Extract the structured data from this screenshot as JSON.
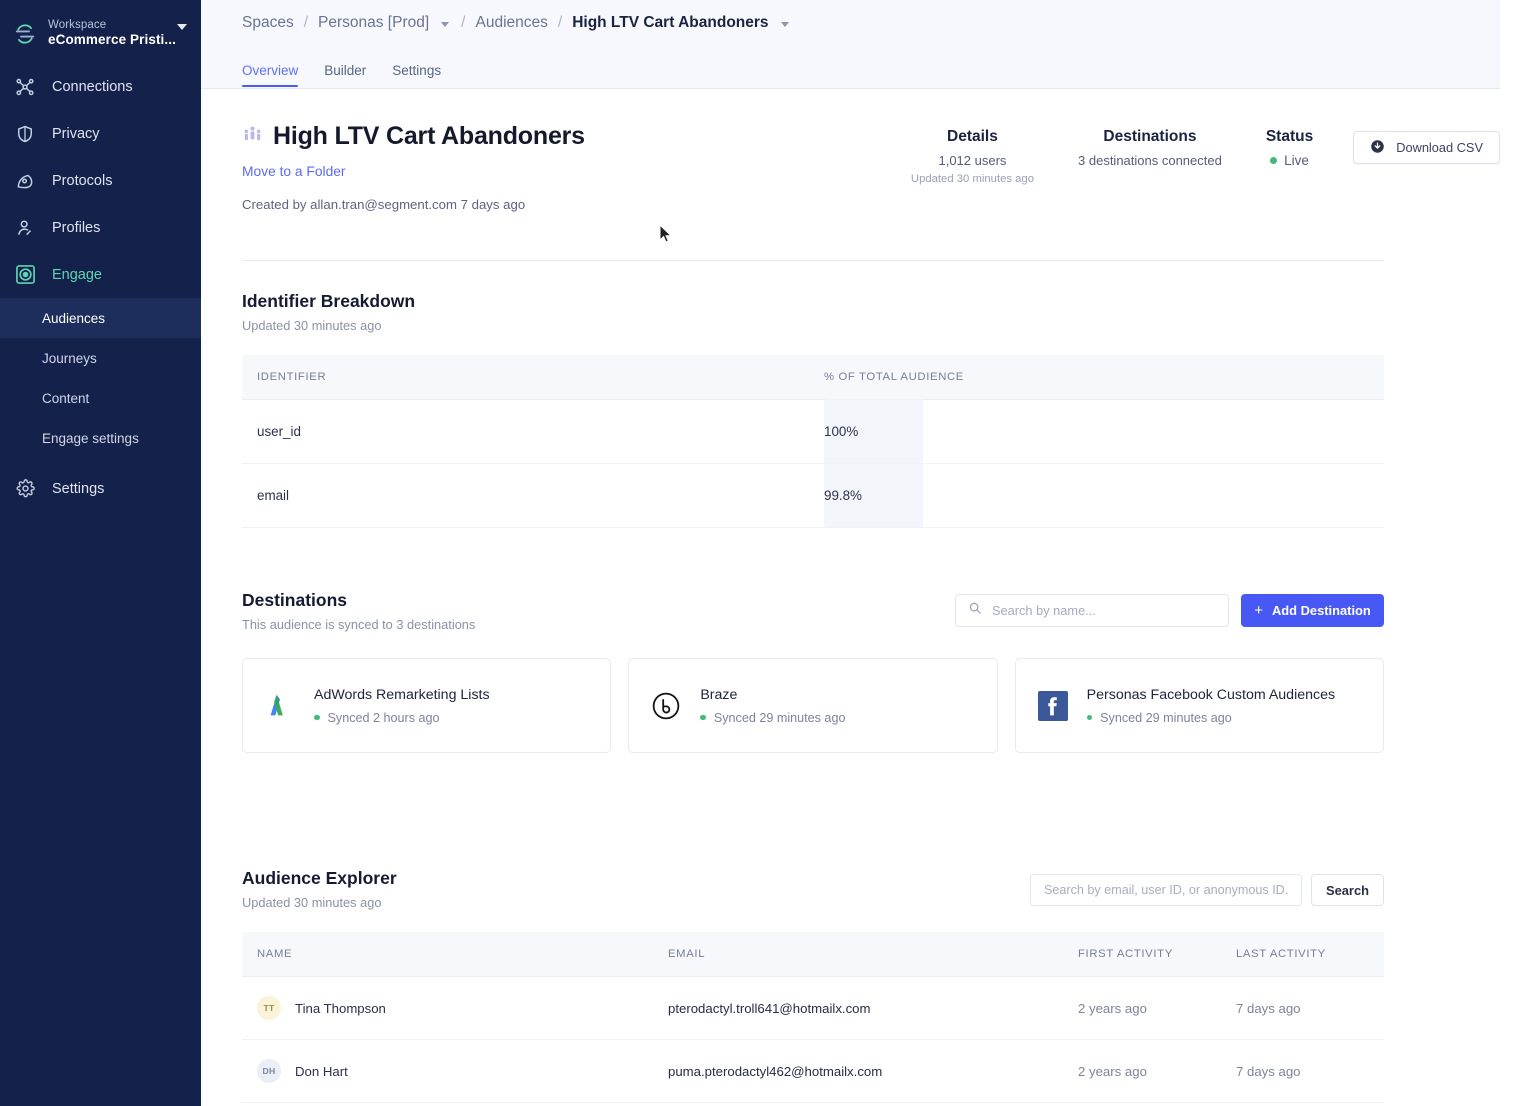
{
  "sidebar": {
    "workspace_label": "Workspace",
    "workspace_name": "eCommerce Pristi...",
    "items": [
      {
        "label": "Connections",
        "icon": "connections-icon"
      },
      {
        "label": "Privacy",
        "icon": "shield-icon"
      },
      {
        "label": "Protocols",
        "icon": "protocols-icon"
      },
      {
        "label": "Profiles",
        "icon": "person-icon"
      },
      {
        "label": "Engage",
        "icon": "engage-icon"
      }
    ],
    "sub_items": [
      {
        "label": "Audiences"
      },
      {
        "label": "Journeys"
      },
      {
        "label": "Content"
      },
      {
        "label": "Engage settings"
      }
    ],
    "settings_label": "Settings",
    "settings_icon": "gear-icon",
    "active_item": "Engage",
    "active_sub_item": "Audiences"
  },
  "breadcrumb": {
    "spaces": "Spaces",
    "space_name": "Personas [Prod]",
    "audiences": "Audiences",
    "current": "High LTV Cart Abandoners",
    "separator": "/"
  },
  "tabs": [
    {
      "label": "Overview",
      "active": true
    },
    {
      "label": "Builder",
      "active": false
    },
    {
      "label": "Settings",
      "active": false
    }
  ],
  "header": {
    "title": "High LTV Cart Abandoners",
    "title_icon": "audience-people-icon",
    "move_to_folder": "Move to a Folder",
    "created_by": "Created by allan.tran@segment.com 7 days ago",
    "stats": [
      {
        "label": "Details",
        "value": "1,012 users",
        "sub": "Updated 30 minutes ago"
      },
      {
        "label": "Destinations",
        "value": "3 destinations connected",
        "sub": ""
      },
      {
        "label": "Status",
        "value": "Live",
        "sub": ""
      }
    ],
    "download_csv": "Download CSV",
    "download_icon": "download-circle-icon",
    "status_color": "#45b97c"
  },
  "identifier_breakdown": {
    "title": "Identifier Breakdown",
    "subtitle": "Updated 30 minutes ago",
    "columns": [
      "IDENTIFIER",
      "% OF TOTAL AUDIENCE"
    ],
    "rows": [
      {
        "identifier": "user_id",
        "percent": "100%"
      },
      {
        "identifier": "email",
        "percent": "99.8%"
      }
    ]
  },
  "destinations": {
    "title": "Destinations",
    "subtitle": "This audience is synced to 3 destinations",
    "search_placeholder": "Search by name...",
    "search_value": "",
    "search_icon": "search-icon",
    "add_label": "Add Destination",
    "add_icon": "plus-icon",
    "cards": [
      {
        "name": "AdWords Remarketing Lists",
        "sync": "Synced 2 hours ago",
        "icon": "google-adwords-icon"
      },
      {
        "name": "Braze",
        "sync": "Synced 29 minutes ago",
        "icon": "braze-icon"
      },
      {
        "name": "Personas Facebook Custom Audiences",
        "sync": "Synced 29 minutes ago",
        "icon": "facebook-icon"
      }
    ]
  },
  "audience_explorer": {
    "title": "Audience Explorer",
    "subtitle": "Updated 30 minutes ago",
    "search_placeholder": "Search by email, user ID, or anonymous ID...",
    "search_value": "",
    "search_button": "Search",
    "columns": [
      "NAME",
      "EMAIL",
      "FIRST ACTIVITY",
      "LAST ACTIVITY"
    ],
    "rows": [
      {
        "initials": "TT",
        "name": "Tina Thompson",
        "email": "pterodactyl.troll641@hotmailx.com",
        "first_activity": "2 years ago",
        "last_activity": "7 days ago"
      },
      {
        "initials": "DH",
        "name": "Don Hart",
        "email": "puma.pterodactyl462@hotmailx.com",
        "first_activity": "2 years ago",
        "last_activity": "7 days ago"
      }
    ]
  },
  "colors": {
    "sidebar_bg": "#13214b",
    "accent_blue": "#4758f4",
    "accent_green": "#5fd4b0",
    "status_green": "#45b97c"
  }
}
